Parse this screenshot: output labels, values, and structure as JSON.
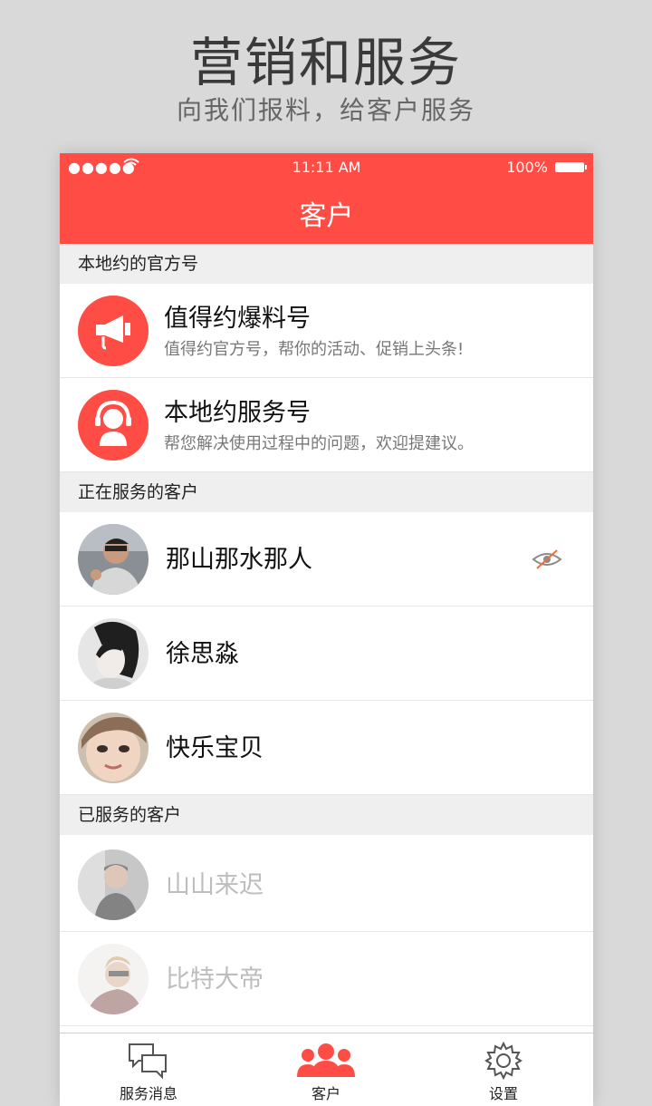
{
  "promo": {
    "title": "营销和服务",
    "subtitle": "向我们报料，给客户服务"
  },
  "status_bar": {
    "signal": "●●●●●",
    "time": "11:11 AM",
    "battery": "100%"
  },
  "nav": {
    "title": "客户"
  },
  "sections": {
    "official": "本地约的官方号",
    "serving": "正在服务的客户",
    "served": "已服务的客户"
  },
  "official_accounts": [
    {
      "title": "值得约爆料号",
      "subtitle": "值得约官方号，帮你的活动、促销上头条!",
      "icon": "megaphone-icon"
    },
    {
      "title": "本地约服务号",
      "subtitle": "帮您解决使用过程中的问题，欢迎提建议。",
      "icon": "support-agent-icon"
    }
  ],
  "serving_customers": [
    {
      "name": "那山那水那人",
      "hidden_indicator": "eye-off-icon"
    },
    {
      "name": "徐思淼"
    },
    {
      "name": "快乐宝贝"
    }
  ],
  "served_customers": [
    {
      "name": "山山来迟"
    },
    {
      "name": "比特大帝"
    }
  ],
  "tabs": [
    {
      "label": "服务消息",
      "icon": "chat-bubbles-icon",
      "active": false
    },
    {
      "label": "客户",
      "icon": "customers-icon",
      "active": true
    },
    {
      "label": "设置",
      "icon": "gear-icon",
      "active": false
    }
  ],
  "colors": {
    "accent": "#ff4d45",
    "muted_text": "#bdbdbd",
    "section_bg": "#efefef"
  }
}
